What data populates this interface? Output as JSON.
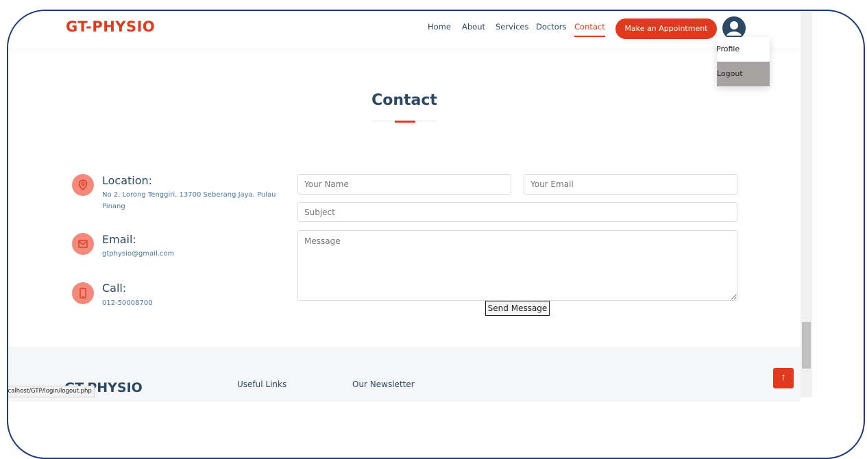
{
  "brand": {
    "name": "GT-PHYSIO",
    "accent": "#e03a1e",
    "navy": "#2c4964"
  },
  "nav": {
    "home": "Home",
    "about": "About",
    "services": "Services",
    "doctors": "Doctors",
    "contact": "Contact",
    "appointment": "Make an Appointment"
  },
  "user_menu": {
    "profile": "Profile",
    "logout": "Logout"
  },
  "section": {
    "title": "Contact"
  },
  "info": {
    "location": {
      "title": "Location:",
      "text": "No 2, Lorong Tenggiri, 13700 Seberang Jaya, Pulau Pinang"
    },
    "email": {
      "title": "Email:",
      "text": "gtphysio@gmail.com"
    },
    "call": {
      "title": "Call:",
      "text": "012-50008700"
    }
  },
  "form": {
    "name_placeholder": "Your Name",
    "email_placeholder": "Your Email",
    "subject_placeholder": "Subject",
    "message_placeholder": "Message",
    "send_label": "Send Message"
  },
  "footer": {
    "logo": "GT-PHYSIO",
    "useful_links": "Useful Links",
    "newsletter": "Our Newsletter",
    "back_to_top": "↑"
  },
  "status_bar": {
    "url": "localhost/GTP/login/logout.php"
  },
  "icons": [
    "user-avatar-icon",
    "map-pin-icon",
    "envelope-icon",
    "phone-icon",
    "arrow-up-icon"
  ]
}
